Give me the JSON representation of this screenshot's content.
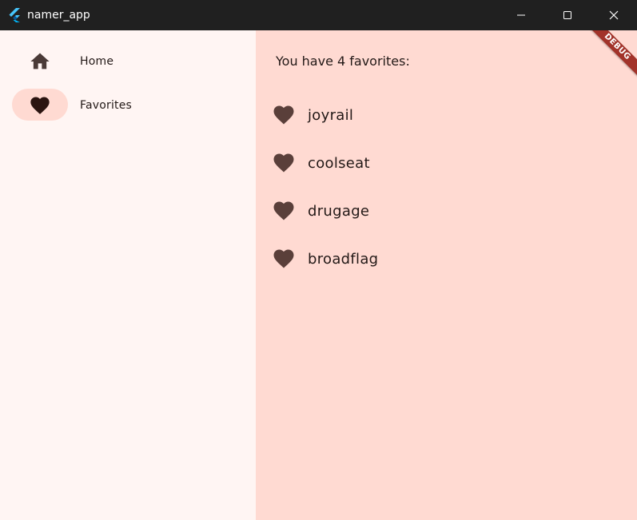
{
  "window": {
    "title": "namer_app"
  },
  "colors": {
    "titlebar": "#202020",
    "sidebar_bg": "#fff5f3",
    "main_bg": "#ffdad2",
    "selected_indicator": "#ffdad2",
    "icon_color": "#5a3f3a",
    "text": "#231917",
    "debug_banner": "#a2332a"
  },
  "sidebar": {
    "items": [
      {
        "label": "Home",
        "icon": "home-icon",
        "selected": false
      },
      {
        "label": "Favorites",
        "icon": "heart-icon",
        "selected": true
      }
    ]
  },
  "main": {
    "summary": "You have 4 favorites:",
    "favorites": [
      {
        "word": "joyrail",
        "icon": "heart-icon"
      },
      {
        "word": "coolseat",
        "icon": "heart-icon"
      },
      {
        "word": "drugage",
        "icon": "heart-icon"
      },
      {
        "word": "broadflag",
        "icon": "heart-icon"
      }
    ]
  },
  "debug_banner": {
    "label": "DEBUG"
  }
}
